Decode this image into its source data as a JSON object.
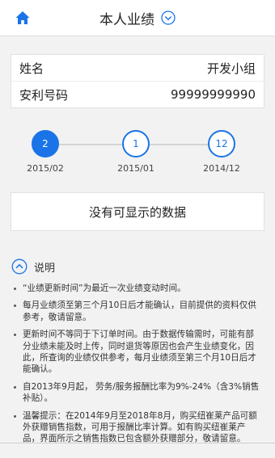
{
  "header": {
    "title": "本人业绩"
  },
  "info": {
    "name_label": "姓名",
    "name_value": "开发小组",
    "id_label": "安利号码",
    "id_value": "99999999990"
  },
  "timeline": {
    "nodes": [
      {
        "count": "2",
        "month": "2015/02",
        "state": "active"
      },
      {
        "count": "1",
        "month": "2015/01",
        "state": "inactive"
      },
      {
        "count": "12",
        "month": "2014/12",
        "state": "inactive"
      }
    ]
  },
  "empty_message": "没有可显示的数据",
  "notes": {
    "title": "说明",
    "items": [
      "“业绩更新时间”为最近一次业绩变动时间。",
      "每月业绩须至第三个月10日后才能确认，目前提供的资料仅供参考，敬请留意。",
      "更新时间不等同于下订单时间。由于数据传输需时，可能有部分业绩未能及时上传，同时退货等原因也会产生业绩变化，因此，所查询的业绩仅供参考，每月业绩须至第三个月10日后才能确认。",
      "自2013年9月起， 劳务/服务报酬比率为9%-24%（含3%销售补贴）。",
      "温馨提示：在2014年9月至2018年8月，购买纽崔莱产品可额外获赠销售指数，可用于报酬比率计算。如有购买纽崔莱产品，界面所示之销售指数已包含额外获赠部分，敬请留意。"
    ]
  },
  "colors": {
    "accent": "#1a74e8",
    "background": "#f2f2f2"
  }
}
